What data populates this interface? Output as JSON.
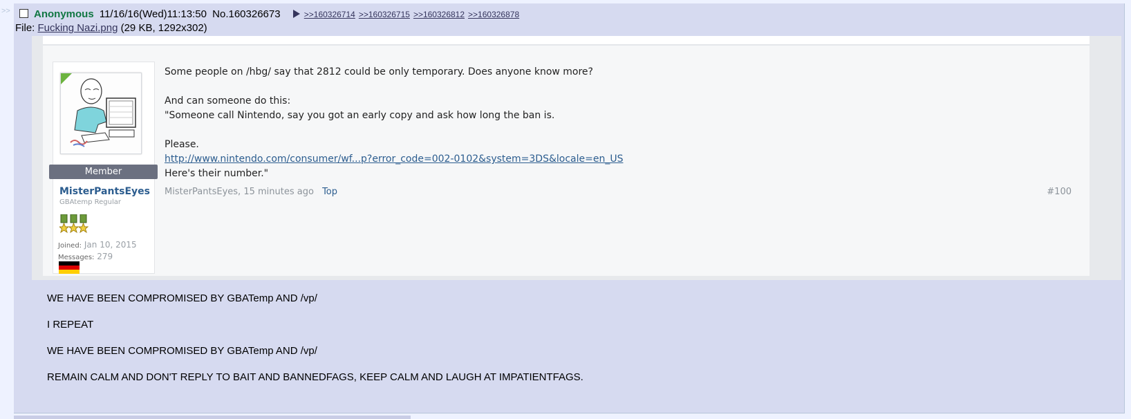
{
  "post": {
    "side_arrows": ">>",
    "name": "Anonymous",
    "datetime": "11/16/16(Wed)11:13:50",
    "post_number": "No.160326673",
    "backlinks": [
      ">>160326714",
      ">>160326715",
      ">>160326812",
      ">>160326878"
    ],
    "file": {
      "label": "File:",
      "filename": "Fucking Nazi.png",
      "meta": "(29 KB, 1292x302)"
    },
    "comment_lines": [
      "WE HAVE BEEN COMPROMISED BY GBATemp AND /vp/",
      "I REPEAT",
      "WE HAVE BEEN COMPROMISED BY GBATemp AND /vp/",
      "REMAIN CALM AND DON'T REPLY TO BAIT AND BANNEDFAGS, KEEP CALM AND LAUGH AT IMPATIENTFAGS."
    ]
  },
  "embedded_image": {
    "user": {
      "badge": "Member",
      "username": "MisterPantsEyes",
      "title": "GBAtemp Regular",
      "joined_label": "Joined:",
      "joined_value": "Jan 10, 2015",
      "messages_label": "Messages:",
      "messages_value": "279"
    },
    "message": {
      "line1": "Some people on /hbg/ say that 2812 could be only temporary. Does anyone know more?",
      "line2": "And can someone do this:",
      "line3": "\"Someone call Nintendo, say you got an early copy and ask how long the ban is.",
      "line4": "Please.",
      "link": "http://www.nintendo.com/consumer/wf...p?error_code=002-0102&system=3DS&locale=en_US",
      "line5": "Here's their number.\""
    },
    "footer": {
      "author_time": "MisterPantsEyes, 15 minutes ago",
      "top_link": "Top",
      "post_index": "#100"
    }
  },
  "colors": {
    "post_bg": "#d6daf0",
    "name_green": "#117743",
    "link_blue": "#34345c",
    "member_badge": "#6b7080",
    "gbatemp_link": "#2c5d8f"
  }
}
